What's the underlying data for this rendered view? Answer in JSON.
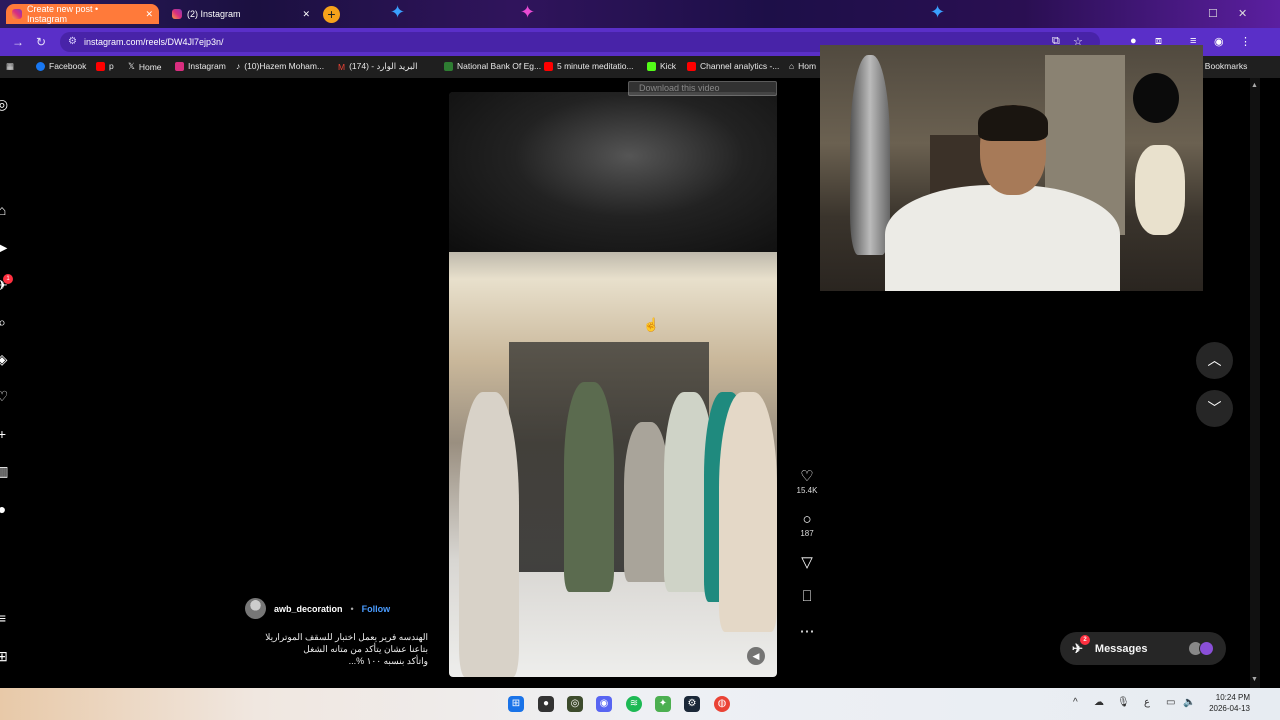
{
  "browser": {
    "tabs": [
      {
        "label": "Create new post • Instagram",
        "active": true
      },
      {
        "label": "(2) Instagram",
        "active": false
      }
    ],
    "url": "instagram.com/reels/DW4Jl7ejp3n/",
    "bookmarks": [
      {
        "label": "Facebook",
        "color": "#1877f2"
      },
      {
        "label": "p",
        "color": "#ff0000"
      },
      {
        "label": "Home",
        "color": "#ffffff"
      },
      {
        "label": "Instagram",
        "color": "#d92e7f"
      },
      {
        "label": "(10)Hazem Moham...",
        "color": "#ffffff"
      },
      {
        "label": "(174) - البريد الوارد",
        "color": "#ea4335"
      },
      {
        "label": "National Bank Of Eg...",
        "color": "#2e7d32"
      },
      {
        "label": "5 minute meditatio...",
        "color": "#ff0000"
      },
      {
        "label": "Kick",
        "color": "#53fc18"
      },
      {
        "label": "Channel analytics -...",
        "color": "#ff0000"
      },
      {
        "label": "Hom",
        "color": "#ffffff"
      }
    ],
    "all_bookmarks": "All Bookmarks"
  },
  "download_bar": "Download this video",
  "reel": {
    "likes": "15.4K",
    "comments": "187",
    "author": "awb_decoration",
    "separator": "•",
    "follow": "Follow",
    "caption_lines": [
      "الهندسه فرير يعمل اختبار للسقف الموتراريلا",
      "بتاعنا عشان يتأكد من متانه الشغل",
      "واتأكد بنسبه ١٠٠ %..."
    ]
  },
  "messages": {
    "label": "Messages",
    "badge": "2"
  },
  "left_nav_badge": "1",
  "taskbar": {
    "time": "10:24 PM",
    "date": "2026-04-13",
    "lang": "ع"
  },
  "colors": {
    "accent": "#4a9cff",
    "badge": "#ff3040",
    "tab_active": "#ff7a3a",
    "address_bar": "#5a2fc8"
  }
}
